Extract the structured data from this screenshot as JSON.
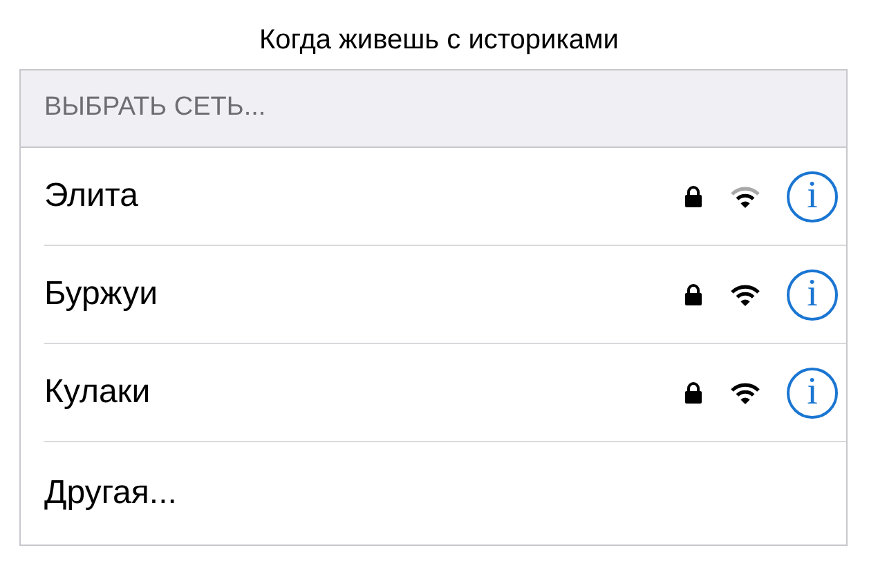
{
  "caption": "Когда живешь с историками",
  "section_header": "ВЫБРАТЬ СЕТЬ...",
  "networks": [
    {
      "name": "Элита",
      "locked": true,
      "weak_signal": true,
      "info_button": "i"
    },
    {
      "name": "Буржуи",
      "locked": true,
      "weak_signal": false,
      "info_button": "i"
    },
    {
      "name": "Кулаки",
      "locked": true,
      "weak_signal": false,
      "info_button": "i"
    }
  ],
  "other_item": "Другая..."
}
